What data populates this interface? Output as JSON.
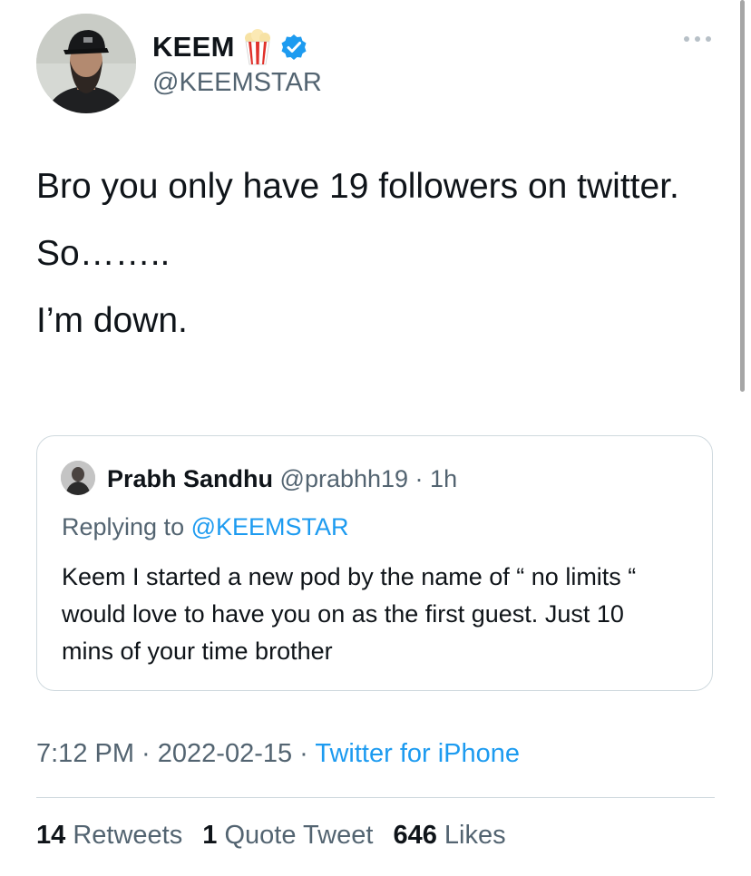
{
  "author": {
    "display_name": "KEEM",
    "name_emoji_icon": "popcorn-icon",
    "verified_icon": "verified-badge-icon",
    "handle": "@KEEMSTAR"
  },
  "more_icon": "more-options-icon",
  "tweet": {
    "paragraphs": [
      "Bro you only have 19 followers on twitter.",
      "So……..",
      "I’m down."
    ]
  },
  "quote": {
    "name": "Prabh Sandhu",
    "handle": "@prabhh19",
    "separator": " · ",
    "time": "1h",
    "replying_prefix": "Replying to ",
    "replying_to": "@KEEMSTAR",
    "text": "Keem I started a new pod by the name of “ no limits “ would love to have you on as the first guest. Just 10 mins of your time brother"
  },
  "meta": {
    "time": "7:12 PM",
    "sep1": " · ",
    "date": "2022-02-15",
    "sep2": " · ",
    "source": "Twitter for iPhone"
  },
  "stats": {
    "retweets_count": "14",
    "retweets_label": "Retweets",
    "quotes_count": "1",
    "quotes_label": "Quote Tweet",
    "likes_count": "646",
    "likes_label": "Likes"
  },
  "colors": {
    "link": "#1d9bf0",
    "secondary_text": "#536471",
    "border": "#cfd9de",
    "verified": "#1d9bf0",
    "popcorn_red": "#e0312b"
  }
}
